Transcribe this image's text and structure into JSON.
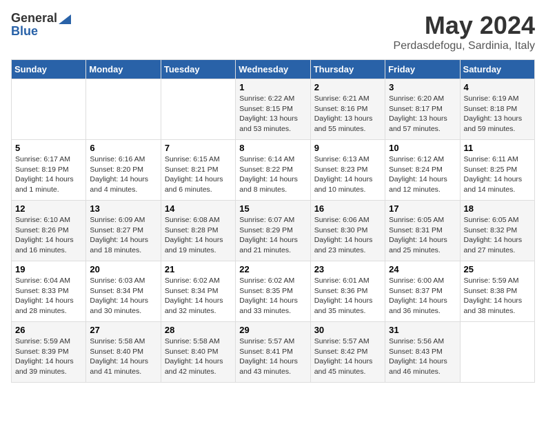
{
  "header": {
    "logo_line1": "General",
    "logo_line2": "Blue",
    "month_title": "May 2024",
    "location": "Perdasdefogu, Sardinia, Italy"
  },
  "days_of_week": [
    "Sunday",
    "Monday",
    "Tuesday",
    "Wednesday",
    "Thursday",
    "Friday",
    "Saturday"
  ],
  "weeks": [
    [
      {
        "day": "",
        "info": ""
      },
      {
        "day": "",
        "info": ""
      },
      {
        "day": "",
        "info": ""
      },
      {
        "day": "1",
        "info": "Sunrise: 6:22 AM\nSunset: 8:15 PM\nDaylight: 13 hours\nand 53 minutes."
      },
      {
        "day": "2",
        "info": "Sunrise: 6:21 AM\nSunset: 8:16 PM\nDaylight: 13 hours\nand 55 minutes."
      },
      {
        "day": "3",
        "info": "Sunrise: 6:20 AM\nSunset: 8:17 PM\nDaylight: 13 hours\nand 57 minutes."
      },
      {
        "day": "4",
        "info": "Sunrise: 6:19 AM\nSunset: 8:18 PM\nDaylight: 13 hours\nand 59 minutes."
      }
    ],
    [
      {
        "day": "5",
        "info": "Sunrise: 6:17 AM\nSunset: 8:19 PM\nDaylight: 14 hours\nand 1 minute."
      },
      {
        "day": "6",
        "info": "Sunrise: 6:16 AM\nSunset: 8:20 PM\nDaylight: 14 hours\nand 4 minutes."
      },
      {
        "day": "7",
        "info": "Sunrise: 6:15 AM\nSunset: 8:21 PM\nDaylight: 14 hours\nand 6 minutes."
      },
      {
        "day": "8",
        "info": "Sunrise: 6:14 AM\nSunset: 8:22 PM\nDaylight: 14 hours\nand 8 minutes."
      },
      {
        "day": "9",
        "info": "Sunrise: 6:13 AM\nSunset: 8:23 PM\nDaylight: 14 hours\nand 10 minutes."
      },
      {
        "day": "10",
        "info": "Sunrise: 6:12 AM\nSunset: 8:24 PM\nDaylight: 14 hours\nand 12 minutes."
      },
      {
        "day": "11",
        "info": "Sunrise: 6:11 AM\nSunset: 8:25 PM\nDaylight: 14 hours\nand 14 minutes."
      }
    ],
    [
      {
        "day": "12",
        "info": "Sunrise: 6:10 AM\nSunset: 8:26 PM\nDaylight: 14 hours\nand 16 minutes."
      },
      {
        "day": "13",
        "info": "Sunrise: 6:09 AM\nSunset: 8:27 PM\nDaylight: 14 hours\nand 18 minutes."
      },
      {
        "day": "14",
        "info": "Sunrise: 6:08 AM\nSunset: 8:28 PM\nDaylight: 14 hours\nand 19 minutes."
      },
      {
        "day": "15",
        "info": "Sunrise: 6:07 AM\nSunset: 8:29 PM\nDaylight: 14 hours\nand 21 minutes."
      },
      {
        "day": "16",
        "info": "Sunrise: 6:06 AM\nSunset: 8:30 PM\nDaylight: 14 hours\nand 23 minutes."
      },
      {
        "day": "17",
        "info": "Sunrise: 6:05 AM\nSunset: 8:31 PM\nDaylight: 14 hours\nand 25 minutes."
      },
      {
        "day": "18",
        "info": "Sunrise: 6:05 AM\nSunset: 8:32 PM\nDaylight: 14 hours\nand 27 minutes."
      }
    ],
    [
      {
        "day": "19",
        "info": "Sunrise: 6:04 AM\nSunset: 8:33 PM\nDaylight: 14 hours\nand 28 minutes."
      },
      {
        "day": "20",
        "info": "Sunrise: 6:03 AM\nSunset: 8:34 PM\nDaylight: 14 hours\nand 30 minutes."
      },
      {
        "day": "21",
        "info": "Sunrise: 6:02 AM\nSunset: 8:34 PM\nDaylight: 14 hours\nand 32 minutes."
      },
      {
        "day": "22",
        "info": "Sunrise: 6:02 AM\nSunset: 8:35 PM\nDaylight: 14 hours\nand 33 minutes."
      },
      {
        "day": "23",
        "info": "Sunrise: 6:01 AM\nSunset: 8:36 PM\nDaylight: 14 hours\nand 35 minutes."
      },
      {
        "day": "24",
        "info": "Sunrise: 6:00 AM\nSunset: 8:37 PM\nDaylight: 14 hours\nand 36 minutes."
      },
      {
        "day": "25",
        "info": "Sunrise: 5:59 AM\nSunset: 8:38 PM\nDaylight: 14 hours\nand 38 minutes."
      }
    ],
    [
      {
        "day": "26",
        "info": "Sunrise: 5:59 AM\nSunset: 8:39 PM\nDaylight: 14 hours\nand 39 minutes."
      },
      {
        "day": "27",
        "info": "Sunrise: 5:58 AM\nSunset: 8:40 PM\nDaylight: 14 hours\nand 41 minutes."
      },
      {
        "day": "28",
        "info": "Sunrise: 5:58 AM\nSunset: 8:40 PM\nDaylight: 14 hours\nand 42 minutes."
      },
      {
        "day": "29",
        "info": "Sunrise: 5:57 AM\nSunset: 8:41 PM\nDaylight: 14 hours\nand 43 minutes."
      },
      {
        "day": "30",
        "info": "Sunrise: 5:57 AM\nSunset: 8:42 PM\nDaylight: 14 hours\nand 45 minutes."
      },
      {
        "day": "31",
        "info": "Sunrise: 5:56 AM\nSunset: 8:43 PM\nDaylight: 14 hours\nand 46 minutes."
      },
      {
        "day": "",
        "info": ""
      }
    ]
  ]
}
